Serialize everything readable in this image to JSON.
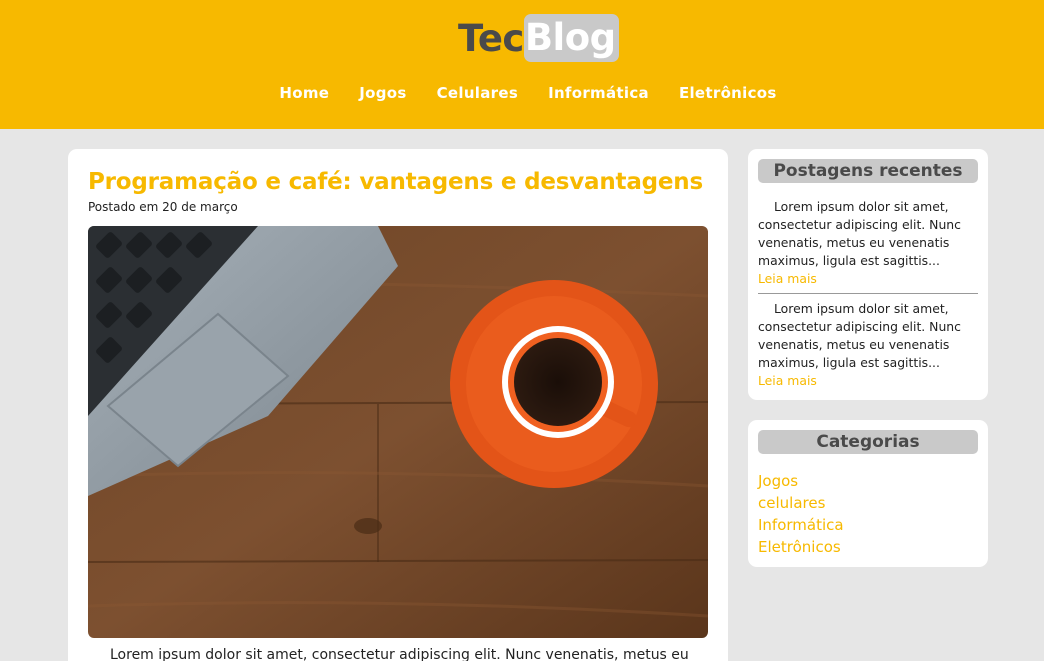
{
  "header": {
    "logo_part1": "Tec",
    "logo_part2": "Blog",
    "nav": [
      {
        "label": "Home"
      },
      {
        "label": "Jogos"
      },
      {
        "label": "Celulares"
      },
      {
        "label": "Informática"
      },
      {
        "label": "Eletrônicos"
      }
    ]
  },
  "post": {
    "title": "Programação e café: vantagens e desvantagens",
    "meta": "Postado em 20 de março",
    "image_icon": "laptop-and-coffee-photo",
    "body": "Lorem ipsum dolor sit amet, consectetur adipiscing elit. Nunc venenatis, metus eu"
  },
  "sidebar": {
    "recent": {
      "title": "Postagens recentes",
      "items": [
        {
          "text": "Lorem ipsum dolor sit amet, consectetur adipiscing elit. Nunc venenatis, metus eu venenatis maximus, ligula est sagittis...",
          "link": "Leia mais"
        },
        {
          "text": "Lorem ipsum dolor sit amet, consectetur adipiscing elit. Nunc venenatis, metus eu venenatis maximus, ligula est sagittis...",
          "link": "Leia mais"
        }
      ]
    },
    "categories": {
      "title": "Categorias",
      "items": [
        "Jogos",
        "celulares",
        "Informática",
        "Eletrônicos"
      ]
    }
  },
  "colors": {
    "accent": "#f7b900",
    "background": "#e6e6e6",
    "widget_title_bg": "#c9c9c9"
  }
}
